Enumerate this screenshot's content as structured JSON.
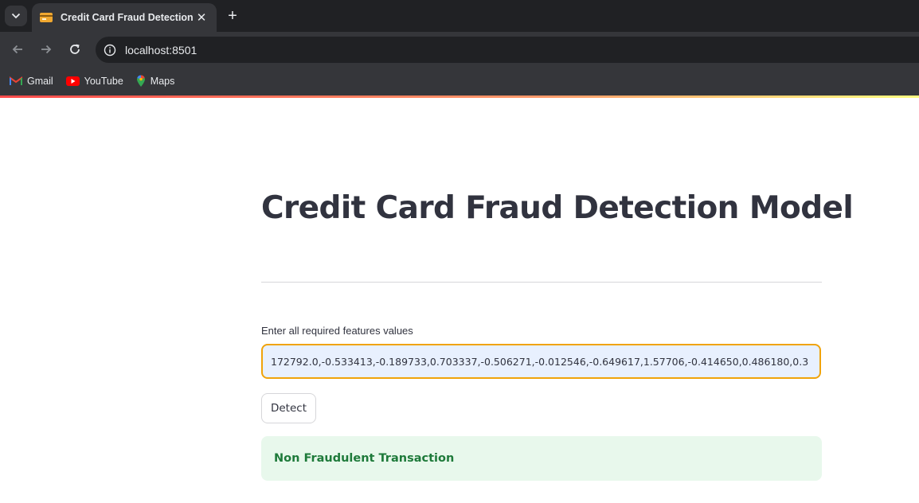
{
  "browser": {
    "tab_title": "Credit Card Fraud Detection",
    "url": "localhost:8501",
    "bookmarks": [
      {
        "label": "Gmail",
        "icon": "gmail-icon"
      },
      {
        "label": "YouTube",
        "icon": "youtube-icon"
      },
      {
        "label": "Maps",
        "icon": "maps-icon"
      }
    ]
  },
  "app": {
    "title": "Credit Card Fraud Detection Model",
    "input_label": "Enter all required features values",
    "input_value": "172792.0,-0.533413,-0.189733,0.703337,-0.506271,-0.012546,-0.649617,1.57706,-0.414650,0.486180,0.3",
    "button_label": "Detect",
    "result_text": "Non Fraudulent Transaction"
  },
  "colors": {
    "input_focus_border": "#f0a30a",
    "success_bg": "#e8f8ec",
    "success_text": "#1e7a3a",
    "accent_gradient_start": "#ff4b4b"
  }
}
